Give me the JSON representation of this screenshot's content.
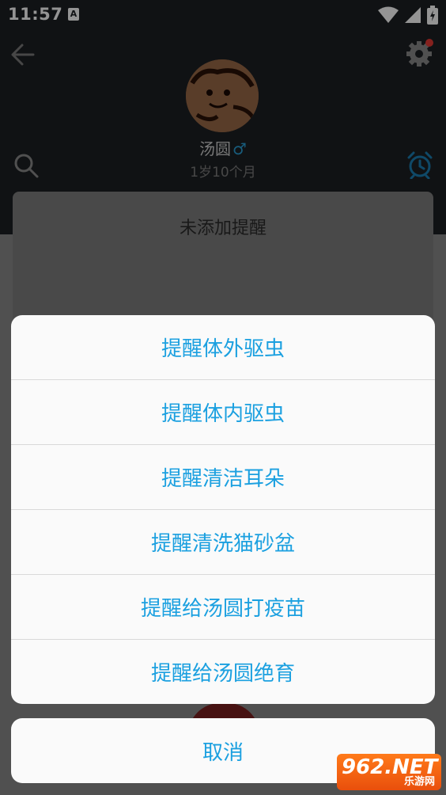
{
  "status_bar": {
    "time": "11:57",
    "notification_letter": "A"
  },
  "header": {
    "pet_name": "汤圆",
    "gender_symbol": "♂",
    "pet_age": "1岁10个月"
  },
  "reminders": {
    "empty_text": "未添加提醒"
  },
  "action_sheet": {
    "items": [
      {
        "label": "提醒体外驱虫"
      },
      {
        "label": "提醒体内驱虫"
      },
      {
        "label": "提醒清洁耳朵"
      },
      {
        "label": "提醒清洗猫砂盆"
      },
      {
        "label": "提醒给汤圆打疫苗"
      },
      {
        "label": "提醒给汤圆绝育"
      }
    ],
    "cancel_label": "取消"
  },
  "watermark": {
    "logo": "962.NET",
    "sub": "乐游网"
  },
  "colors": {
    "accent": "#1ba0e0",
    "header_bg": "#1d2024",
    "notification_dot": "#e53935"
  },
  "icons": [
    "back-arrow-icon",
    "gear-icon",
    "search-icon",
    "alarm-clock-icon",
    "wifi-icon",
    "signal-icon",
    "battery-icon"
  ]
}
